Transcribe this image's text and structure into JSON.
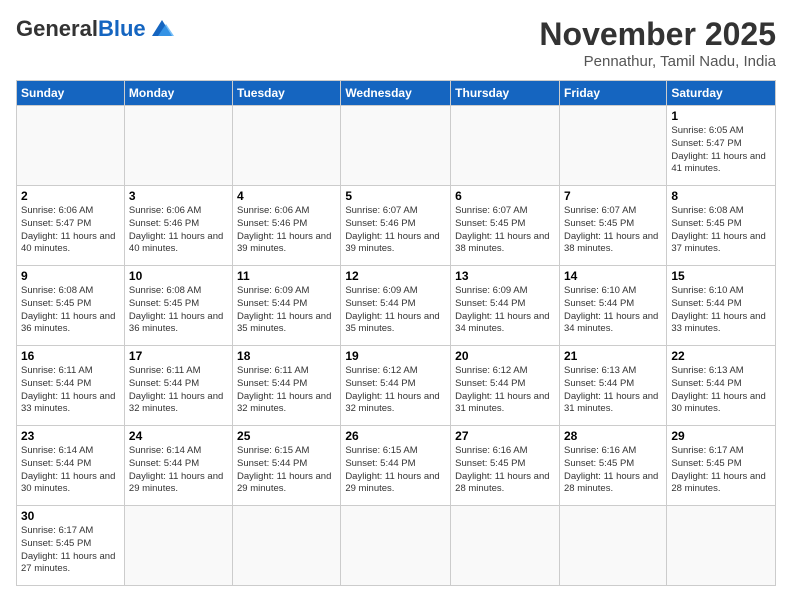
{
  "logo": {
    "general": "General",
    "blue": "Blue"
  },
  "header": {
    "month_title": "November 2025",
    "location": "Pennathur, Tamil Nadu, India"
  },
  "weekdays": [
    "Sunday",
    "Monday",
    "Tuesday",
    "Wednesday",
    "Thursday",
    "Friday",
    "Saturday"
  ],
  "weeks": [
    [
      {
        "day": "",
        "info": ""
      },
      {
        "day": "",
        "info": ""
      },
      {
        "day": "",
        "info": ""
      },
      {
        "day": "",
        "info": ""
      },
      {
        "day": "",
        "info": ""
      },
      {
        "day": "",
        "info": ""
      },
      {
        "day": "1",
        "info": "Sunrise: 6:05 AM\nSunset: 5:47 PM\nDaylight: 11 hours and 41 minutes."
      }
    ],
    [
      {
        "day": "2",
        "info": "Sunrise: 6:06 AM\nSunset: 5:47 PM\nDaylight: 11 hours and 40 minutes."
      },
      {
        "day": "3",
        "info": "Sunrise: 6:06 AM\nSunset: 5:46 PM\nDaylight: 11 hours and 40 minutes."
      },
      {
        "day": "4",
        "info": "Sunrise: 6:06 AM\nSunset: 5:46 PM\nDaylight: 11 hours and 39 minutes."
      },
      {
        "day": "5",
        "info": "Sunrise: 6:07 AM\nSunset: 5:46 PM\nDaylight: 11 hours and 39 minutes."
      },
      {
        "day": "6",
        "info": "Sunrise: 6:07 AM\nSunset: 5:45 PM\nDaylight: 11 hours and 38 minutes."
      },
      {
        "day": "7",
        "info": "Sunrise: 6:07 AM\nSunset: 5:45 PM\nDaylight: 11 hours and 38 minutes."
      },
      {
        "day": "8",
        "info": "Sunrise: 6:08 AM\nSunset: 5:45 PM\nDaylight: 11 hours and 37 minutes."
      }
    ],
    [
      {
        "day": "9",
        "info": "Sunrise: 6:08 AM\nSunset: 5:45 PM\nDaylight: 11 hours and 36 minutes."
      },
      {
        "day": "10",
        "info": "Sunrise: 6:08 AM\nSunset: 5:45 PM\nDaylight: 11 hours and 36 minutes."
      },
      {
        "day": "11",
        "info": "Sunrise: 6:09 AM\nSunset: 5:44 PM\nDaylight: 11 hours and 35 minutes."
      },
      {
        "day": "12",
        "info": "Sunrise: 6:09 AM\nSunset: 5:44 PM\nDaylight: 11 hours and 35 minutes."
      },
      {
        "day": "13",
        "info": "Sunrise: 6:09 AM\nSunset: 5:44 PM\nDaylight: 11 hours and 34 minutes."
      },
      {
        "day": "14",
        "info": "Sunrise: 6:10 AM\nSunset: 5:44 PM\nDaylight: 11 hours and 34 minutes."
      },
      {
        "day": "15",
        "info": "Sunrise: 6:10 AM\nSunset: 5:44 PM\nDaylight: 11 hours and 33 minutes."
      }
    ],
    [
      {
        "day": "16",
        "info": "Sunrise: 6:11 AM\nSunset: 5:44 PM\nDaylight: 11 hours and 33 minutes."
      },
      {
        "day": "17",
        "info": "Sunrise: 6:11 AM\nSunset: 5:44 PM\nDaylight: 11 hours and 32 minutes."
      },
      {
        "day": "18",
        "info": "Sunrise: 6:11 AM\nSunset: 5:44 PM\nDaylight: 11 hours and 32 minutes."
      },
      {
        "day": "19",
        "info": "Sunrise: 6:12 AM\nSunset: 5:44 PM\nDaylight: 11 hours and 32 minutes."
      },
      {
        "day": "20",
        "info": "Sunrise: 6:12 AM\nSunset: 5:44 PM\nDaylight: 11 hours and 31 minutes."
      },
      {
        "day": "21",
        "info": "Sunrise: 6:13 AM\nSunset: 5:44 PM\nDaylight: 11 hours and 31 minutes."
      },
      {
        "day": "22",
        "info": "Sunrise: 6:13 AM\nSunset: 5:44 PM\nDaylight: 11 hours and 30 minutes."
      }
    ],
    [
      {
        "day": "23",
        "info": "Sunrise: 6:14 AM\nSunset: 5:44 PM\nDaylight: 11 hours and 30 minutes."
      },
      {
        "day": "24",
        "info": "Sunrise: 6:14 AM\nSunset: 5:44 PM\nDaylight: 11 hours and 29 minutes."
      },
      {
        "day": "25",
        "info": "Sunrise: 6:15 AM\nSunset: 5:44 PM\nDaylight: 11 hours and 29 minutes."
      },
      {
        "day": "26",
        "info": "Sunrise: 6:15 AM\nSunset: 5:44 PM\nDaylight: 11 hours and 29 minutes."
      },
      {
        "day": "27",
        "info": "Sunrise: 6:16 AM\nSunset: 5:45 PM\nDaylight: 11 hours and 28 minutes."
      },
      {
        "day": "28",
        "info": "Sunrise: 6:16 AM\nSunset: 5:45 PM\nDaylight: 11 hours and 28 minutes."
      },
      {
        "day": "29",
        "info": "Sunrise: 6:17 AM\nSunset: 5:45 PM\nDaylight: 11 hours and 28 minutes."
      }
    ],
    [
      {
        "day": "30",
        "info": "Sunrise: 6:17 AM\nSunset: 5:45 PM\nDaylight: 11 hours and 27 minutes."
      },
      {
        "day": "",
        "info": ""
      },
      {
        "day": "",
        "info": ""
      },
      {
        "day": "",
        "info": ""
      },
      {
        "day": "",
        "info": ""
      },
      {
        "day": "",
        "info": ""
      },
      {
        "day": "",
        "info": ""
      }
    ]
  ]
}
